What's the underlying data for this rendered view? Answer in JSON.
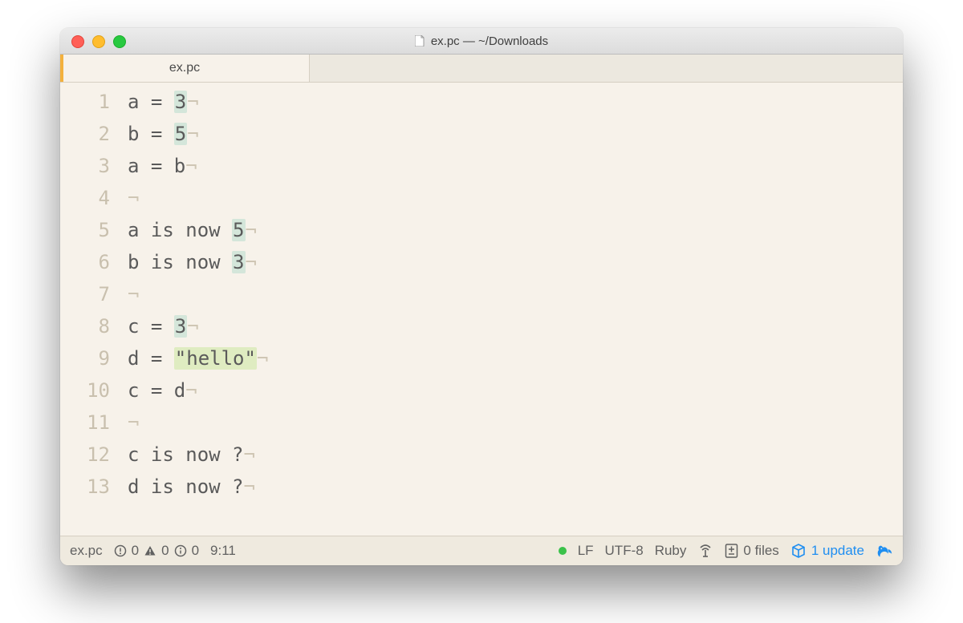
{
  "window": {
    "title": "ex.pc — ~/Downloads"
  },
  "tab": {
    "label": "ex.pc"
  },
  "code_lines": [
    {
      "n": "1",
      "segs": [
        {
          "t": "a = "
        },
        {
          "t": "3",
          "c": "hl-num"
        },
        {
          "t": "¬",
          "c": "eol"
        }
      ]
    },
    {
      "n": "2",
      "segs": [
        {
          "t": "b = "
        },
        {
          "t": "5",
          "c": "hl-num"
        },
        {
          "t": "¬",
          "c": "eol"
        }
      ]
    },
    {
      "n": "3",
      "segs": [
        {
          "t": "a = b"
        },
        {
          "t": "¬",
          "c": "eol"
        }
      ]
    },
    {
      "n": "4",
      "segs": [
        {
          "t": "¬",
          "c": "eol"
        }
      ]
    },
    {
      "n": "5",
      "segs": [
        {
          "t": "a is now "
        },
        {
          "t": "5",
          "c": "hl-num"
        },
        {
          "t": "¬",
          "c": "eol"
        }
      ]
    },
    {
      "n": "6",
      "segs": [
        {
          "t": "b is now "
        },
        {
          "t": "3",
          "c": "hl-num"
        },
        {
          "t": "¬",
          "c": "eol"
        }
      ]
    },
    {
      "n": "7",
      "segs": [
        {
          "t": "¬",
          "c": "eol"
        }
      ]
    },
    {
      "n": "8",
      "segs": [
        {
          "t": "c = "
        },
        {
          "t": "3",
          "c": "hl-num"
        },
        {
          "t": "¬",
          "c": "eol"
        }
      ]
    },
    {
      "n": "9",
      "segs": [
        {
          "t": "d = "
        },
        {
          "t": "\"hello\"",
          "c": "hl-str"
        },
        {
          "t": "¬",
          "c": "eol"
        }
      ]
    },
    {
      "n": "10",
      "segs": [
        {
          "t": "c = d"
        },
        {
          "t": "¬",
          "c": "eol"
        }
      ]
    },
    {
      "n": "11",
      "segs": [
        {
          "t": "¬",
          "c": "eol"
        }
      ]
    },
    {
      "n": "12",
      "segs": [
        {
          "t": "c is now ?"
        },
        {
          "t": "¬",
          "c": "eol"
        }
      ]
    },
    {
      "n": "13",
      "segs": [
        {
          "t": "d is now ?"
        },
        {
          "t": "¬",
          "c": "eol"
        }
      ]
    }
  ],
  "status": {
    "filename": "ex.pc",
    "errors": "0",
    "warnings": "0",
    "infos": "0",
    "cursor": "9:11",
    "eol": "LF",
    "encoding": "UTF-8",
    "language": "Ruby",
    "git_files": "0 files",
    "updates": "1 update"
  }
}
